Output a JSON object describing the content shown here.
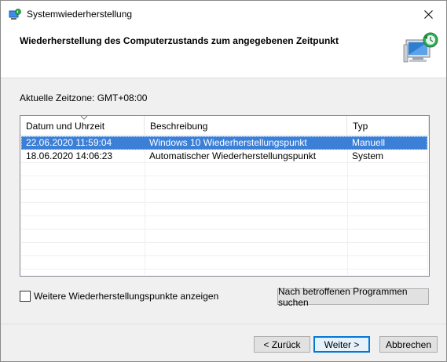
{
  "window": {
    "title": "Systemwiederherstellung",
    "icon": "system-restore-icon",
    "close_icon": "close-icon"
  },
  "header": {
    "title": "Wiederherstellung des Computerzustands zum angegebenen Zeitpunkt",
    "icon": "computer-restore-icon"
  },
  "timezone_label": "Aktuelle Zeitzone: GMT+08:00",
  "table": {
    "columns": [
      "Datum und Uhrzeit",
      "Beschreibung",
      "Typ"
    ],
    "sorted_column": "Datum und Uhrzeit",
    "rows": [
      {
        "date": "22.06.2020 11:59:04",
        "description": "Windows 10 Wiederherstellungspunkt",
        "type": "Manuell",
        "selected": true
      },
      {
        "date": "18.06.2020 14:06:23",
        "description": "Automatischer Wiederherstellungspunkt",
        "type": "System",
        "selected": false
      }
    ]
  },
  "checkbox": {
    "label": "Weitere Wiederherstellungspunkte anzeigen",
    "checked": false
  },
  "buttons": {
    "affected_programs": "Nach betroffenen Programmen suchen",
    "back": "< Zurück",
    "next": "Weiter >",
    "cancel": "Abbrechen"
  },
  "colors": {
    "selection": "#3b7fd7",
    "default_button_border": "#0078d7"
  }
}
